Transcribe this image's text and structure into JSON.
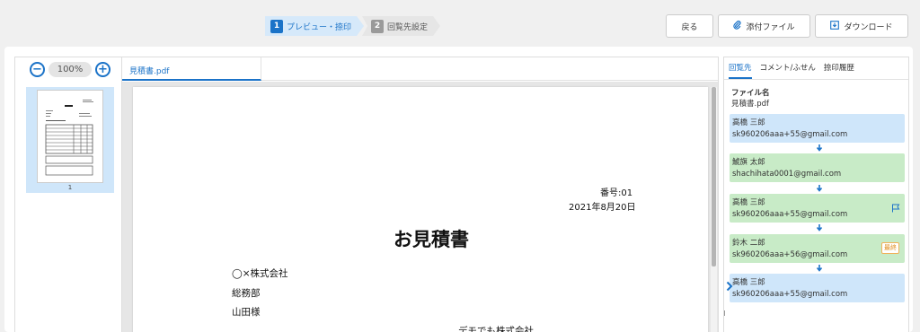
{
  "steps": [
    {
      "num": "1",
      "label": "プレビュー・捺印"
    },
    {
      "num": "2",
      "label": "回覧先設定"
    }
  ],
  "toolbar": {
    "back_label": "戻る",
    "attach_label": "添付ファイル",
    "download_label": "ダウンロード",
    "attach_icon": "paperclip-icon",
    "download_icon": "download-icon"
  },
  "thumbnails": {
    "zoom": "100%",
    "zoom_out_icon": "minus-circle-icon",
    "zoom_in_icon": "plus-circle-icon",
    "pages": [
      {
        "number": "1"
      }
    ]
  },
  "document": {
    "tab_label": "見積書.pdf",
    "number_line": "番号:01",
    "date": "2021年8月20日",
    "title": "お見積書",
    "company": "◯×株式会社",
    "department": "総務部",
    "recipient": "山田様",
    "sender": "デモでも株式会社"
  },
  "recipients_panel": {
    "tabs": [
      "回覧先",
      "コメント/ふせん",
      "捺印履歴"
    ],
    "active_tab": "回覧先",
    "file_label": "ファイル名",
    "file_name": "見積書.pdf",
    "cards": [
      {
        "name": "高橋 三郎",
        "email": "sk960206aaa+55@gmail.com",
        "color": "#cfe6fa"
      },
      {
        "name": "鯱旗 太郎",
        "email": "shachihata0001@gmail.com",
        "color": "#c8ebc7"
      },
      {
        "name": "高橋 三郎",
        "email": "sk960206aaa+55@gmail.com",
        "color": "#c8ebc7",
        "icon": "flag-icon"
      },
      {
        "name": "鈴木 二郎",
        "email": "sk960206aaa+56@gmail.com",
        "color": "#c8ebc7",
        "badge": "最終"
      },
      {
        "name": "高橋 三郎",
        "email": "sk960206aaa+55@gmail.com",
        "color": "#cfe6fa",
        "icon": "current-marker-icon"
      }
    ]
  },
  "colors": {
    "accent": "#1b73c8",
    "card_blue": "#cfe6fa",
    "card_green": "#c8ebc7",
    "badge_orange": "#e08b1a"
  }
}
